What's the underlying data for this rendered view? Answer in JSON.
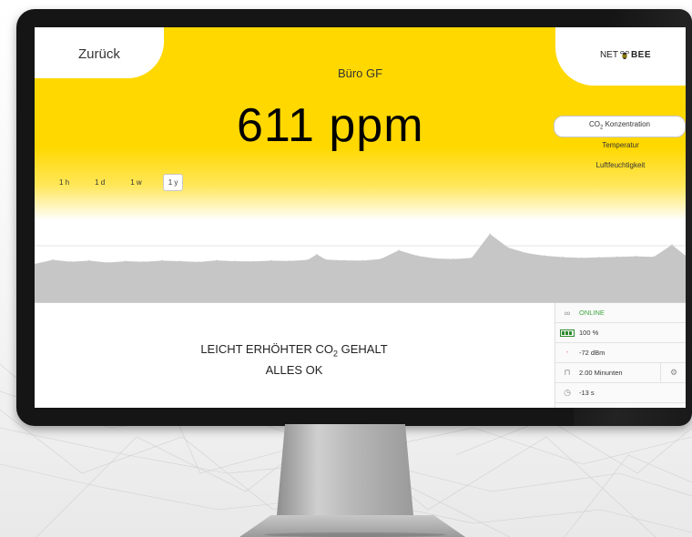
{
  "header": {
    "back_label": "Zurück",
    "room_name": "Büro GF",
    "logo_left": "NET",
    "logo_right": "BEE"
  },
  "reading": {
    "value": "611",
    "unit": "ppm",
    "display": "611 ppm"
  },
  "time_ranges": [
    {
      "label": "1 h",
      "active": false
    },
    {
      "label": "1 d",
      "active": false
    },
    {
      "label": "1 w",
      "active": false
    },
    {
      "label": "1 y",
      "active": true
    }
  ],
  "metrics": [
    {
      "label_prefix": "CO",
      "label_sub": "2",
      "label_suffix": " Konzentration",
      "active": true
    },
    {
      "label": "Temperatur",
      "active": false
    },
    {
      "label": "Luftfeuchtigkeit",
      "active": false
    }
  ],
  "message": {
    "line1_prefix": "LEICHT ERHÖHTER CO",
    "line1_sub": "2",
    "line1_suffix": " GEHALT",
    "line2": "ALLES OK"
  },
  "status": {
    "connection": "ONLINE",
    "battery": "100 %",
    "signal": "-72 dBm",
    "interval": "2.00 Minunten",
    "last_update": "-13 s"
  },
  "colors": {
    "accent_yellow": "#ffd800",
    "online_green": "#3fa53f",
    "chart_fill": "#c6c6c6"
  },
  "chart_data": {
    "type": "area",
    "x": [
      0,
      20,
      40,
      60,
      80,
      100,
      120,
      140,
      160,
      180,
      200,
      220,
      240,
      260,
      280,
      300,
      310,
      320,
      340,
      360,
      380,
      400,
      420,
      440,
      460,
      480,
      500,
      520,
      540,
      560,
      580,
      600,
      620,
      640,
      660,
      680,
      700,
      715
    ],
    "values": [
      540,
      555,
      548,
      552,
      545,
      550,
      548,
      552,
      550,
      547,
      553,
      550,
      549,
      552,
      551,
      555,
      575,
      556,
      553,
      552,
      558,
      590,
      570,
      560,
      558,
      562,
      650,
      600,
      580,
      570,
      565,
      562,
      564,
      566,
      568,
      566,
      610,
      570
    ],
    "ylim": [
      400,
      700
    ],
    "grid": true
  }
}
